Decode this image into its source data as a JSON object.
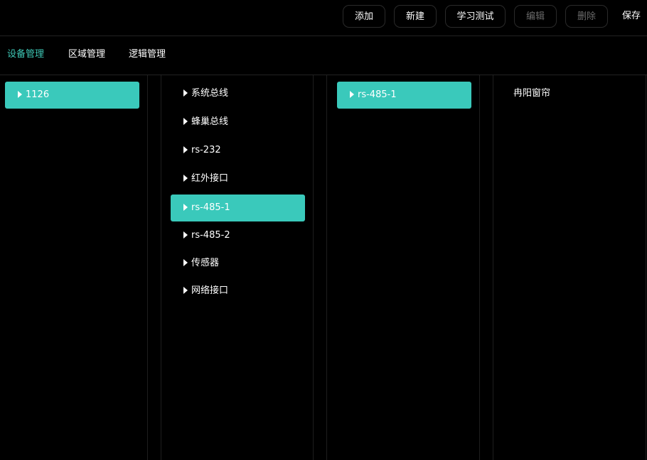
{
  "toolbar": {
    "add_label": "添加",
    "new_label": "新建",
    "learn_test_label": "学习测试",
    "edit_label": "编辑",
    "delete_label": "删除",
    "save_label": "保存"
  },
  "tabs": [
    {
      "label": "设备管理",
      "active": true
    },
    {
      "label": "区域管理",
      "active": false
    },
    {
      "label": "逻辑管理",
      "active": false
    }
  ],
  "columns": {
    "devices": [
      {
        "label": "1126",
        "selected": true
      }
    ],
    "interfaces": [
      {
        "label": "系统总线",
        "selected": false
      },
      {
        "label": "蜂巢总线",
        "selected": false
      },
      {
        "label": "rs-232",
        "selected": false
      },
      {
        "label": "红外接口",
        "selected": false
      },
      {
        "label": "rs-485-1",
        "selected": true
      },
      {
        "label": "rs-485-2",
        "selected": false
      },
      {
        "label": "传感器",
        "selected": false
      },
      {
        "label": "网络接口",
        "selected": false
      }
    ],
    "sub_interfaces": [
      {
        "label": "rs-485-1",
        "selected": true
      }
    ],
    "endpoints": [
      {
        "label": "冉阳窗帘"
      }
    ]
  },
  "colors": {
    "accent": "#3ec9b7",
    "selected_bg": "#3ac9bb",
    "background": "#000000",
    "disabled_text": "#6a6a6a"
  },
  "icons": {
    "item_caret": "caret-right-icon"
  }
}
